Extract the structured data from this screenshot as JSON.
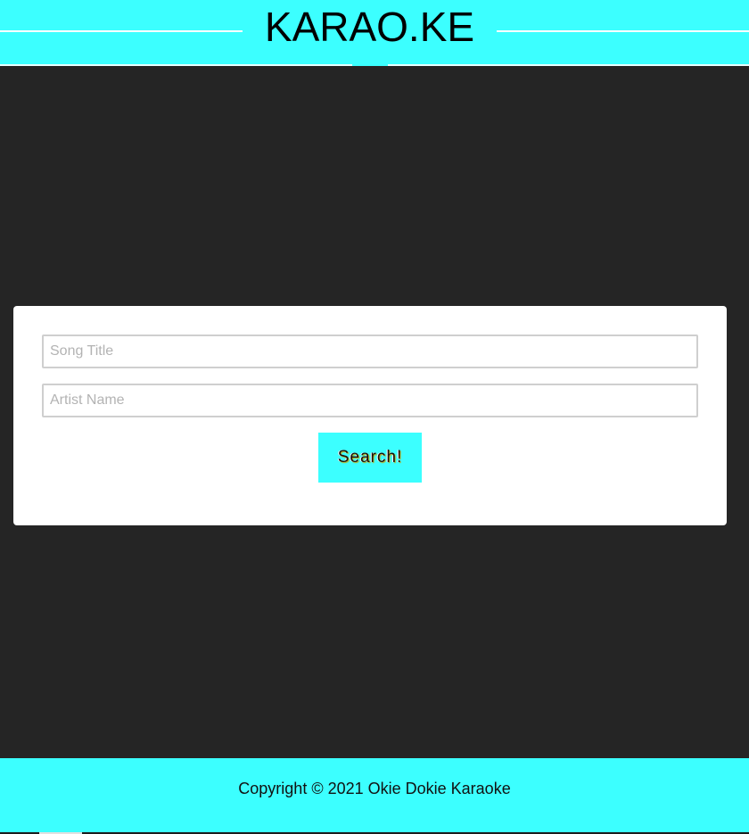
{
  "header": {
    "title": "KARAO.KE"
  },
  "search": {
    "song_placeholder": "Song Title",
    "song_value": "",
    "artist_placeholder": "Artist Name",
    "artist_value": "",
    "button_label": "Search!"
  },
  "footer": {
    "copyright": "Copyright © 2021 Okie Dokie Karaoke"
  },
  "colors": {
    "accent": "#3cffff",
    "background": "#252525",
    "card": "#ffffff"
  }
}
